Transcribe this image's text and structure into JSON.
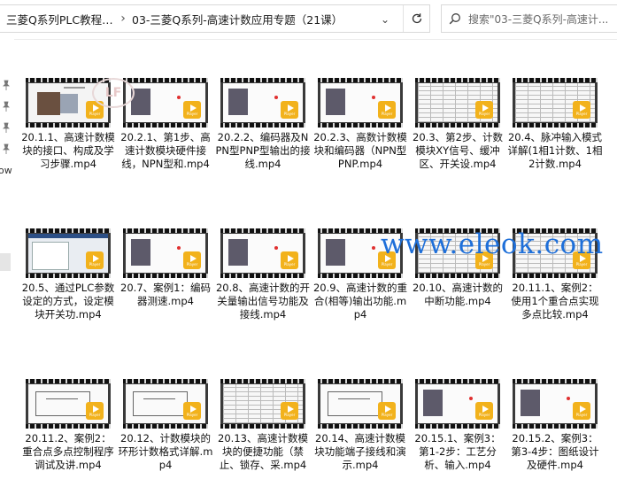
{
  "address": {
    "root_crumb": "三菱Q系列PLC教程 ...",
    "separator": "›",
    "current_crumb": "03-三菱Q系列-高速计数应用专题（21课）",
    "chevron": "⌄"
  },
  "search": {
    "placeholder": "搜索\"03-三菱Q系列-高速计..."
  },
  "nav": {
    "partial_label": "ow"
  },
  "watermark": {
    "text": "www.eleok.com",
    "logo": "LF"
  },
  "badge": {
    "label": "Player"
  },
  "files": [
    {
      "caption": "20.1.1、高速计数模块的接口、构成及学习步骤.mp4",
      "art": "s-doc"
    },
    {
      "caption": "20.2.1、第1步、高速计数模块硬件接线，NPN型和.mp4",
      "art": "s-white"
    },
    {
      "caption": "20.2.2、编码器及NPN型PNP型输出的接线.mp4",
      "art": "s-white"
    },
    {
      "caption": "20.2.3、高数计数模块和编码器（NPN型PNP.mp4",
      "art": "s-white"
    },
    {
      "caption": "20.3、第2步、计数模块XY信号、缓冲区、开关设.mp4",
      "art": "s-table"
    },
    {
      "caption": "20.4、脉冲输入模式详解(1相1计数、1相2计数.mp4",
      "art": "s-table"
    },
    {
      "caption": "20.5、通过PLC参数设定的方式，设定模块开关功.mp4",
      "art": "s-soft"
    },
    {
      "caption": "20.7、案例1：编码器测速.mp4",
      "art": "s-white"
    },
    {
      "caption": "20.8、高速计数的开关量输出信号功能及接线.mp4",
      "art": "s-white"
    },
    {
      "caption": "20.9、高速计数的重合(相等)输出功能.mp4",
      "art": "s-white"
    },
    {
      "caption": "20.10、高速计数的中断功能.mp4",
      "art": "s-table"
    },
    {
      "caption": "20.11.1、案例2：使用1个重合点实现多点比较.mp4",
      "art": "s-table"
    },
    {
      "caption": "20.11.2、案例2：重合点多点控制程序调试及讲.mp4",
      "art": "s-wire"
    },
    {
      "caption": "20.12、计数模块的环形计数格式详解.mp4",
      "art": "s-wire"
    },
    {
      "caption": "20.13、高速计数模块的便捷功能（禁止、锁存、采.mp4",
      "art": "s-table"
    },
    {
      "caption": "20.14、高速计数模块功能端子接线和演示.mp4",
      "art": "s-wire"
    },
    {
      "caption": "20.15.1、案例3：第1-2步：工艺分析、输入.mp4",
      "art": "s-white"
    },
    {
      "caption": "20.15.2、案例3：第3-4步：图纸设计及硬件.mp4",
      "art": "s-white"
    }
  ]
}
